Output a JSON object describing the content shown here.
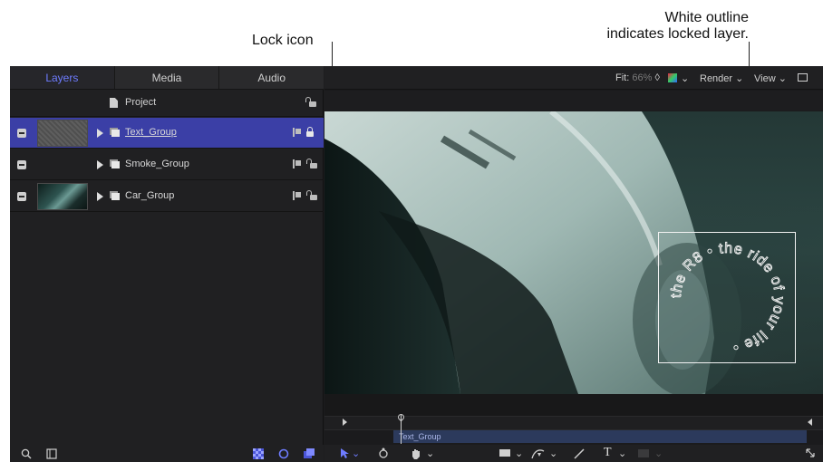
{
  "callouts": {
    "lock_icon": "Lock icon",
    "outline_line1": "White outline",
    "outline_line2": "indicates locked layer."
  },
  "tabs": [
    {
      "label": "Layers",
      "active": true
    },
    {
      "label": "Media",
      "active": false
    },
    {
      "label": "Audio",
      "active": false
    }
  ],
  "project": {
    "label": "Project",
    "lock": "lock-open-icon"
  },
  "layers": [
    {
      "name": "Text_Group",
      "selected": true,
      "locked": true,
      "thumbnail": "text-pattern"
    },
    {
      "name": "Smoke_Group",
      "selected": false,
      "locked": false,
      "thumbnail": "none"
    },
    {
      "name": "Car_Group",
      "selected": false,
      "locked": false,
      "thumbnail": "car"
    }
  ],
  "toolbar": {
    "fit_label": "Fit:",
    "fit_value": "66%",
    "render_label": "Render",
    "view_label": "View"
  },
  "canvas": {
    "circular_text": "the R8 • the ride of your life •"
  },
  "timeline": {
    "clip_label": "Text_Group"
  },
  "colors": {
    "accent": "#6e7cff",
    "selected_row": "#3b3fa6",
    "outline": "#f2f2f2"
  }
}
